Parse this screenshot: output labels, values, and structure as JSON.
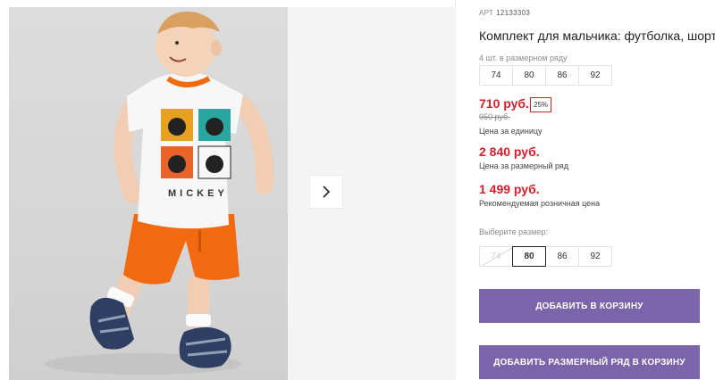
{
  "gallery": {
    "next_icon": "chevron-right-icon",
    "print_text": "MICKEY",
    "colors": {
      "shirt": "#f7f7f7",
      "trim": "#f26a10",
      "shorts": "#f26a10",
      "sandals": "#2f3f63"
    }
  },
  "product": {
    "art_label": "АРТ",
    "art_number": "12133303",
    "title": "Комплект для мальчика: футболка, шорты",
    "pack_label": "4 шт. в размерном ряду",
    "pack_sizes": [
      "74",
      "80",
      "86",
      "92"
    ],
    "price_unit": "710 руб.",
    "discount": "25%",
    "old_price": "950 руб.",
    "price_unit_caption": "Цена за единицу",
    "price_pack": "2 840 руб.",
    "price_pack_caption": "Цена за размерный ряд",
    "price_retail": "1 499 руб.",
    "price_retail_caption": "Рекомендуемая розничная цена",
    "choose_label": "Выберите размер:",
    "choose_sizes": [
      "74",
      "80",
      "86",
      "92"
    ],
    "selected_size": "80",
    "disabled_size": "74",
    "add_to_cart": "Добавить в корзину",
    "add_pack_to_cart": "Добавить размерный ряд в корзину"
  },
  "colors": {
    "accent": "#7a64aa",
    "price": "#d31f2b"
  }
}
